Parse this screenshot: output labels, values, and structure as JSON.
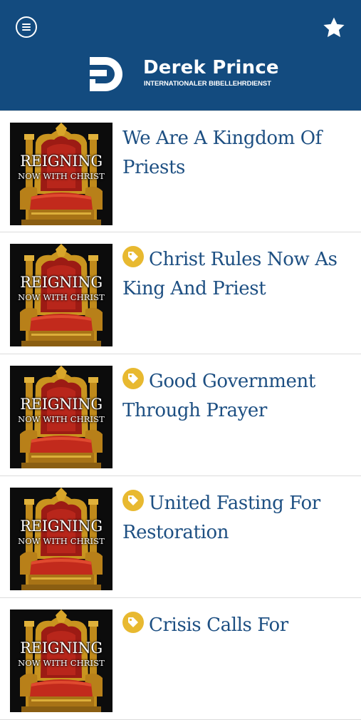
{
  "header": {
    "brand_name": "Derek Prince",
    "brand_sub": "INTERNATIONALER BIBELLEHRDIENST",
    "menu_icon": "menu-icon",
    "favorite_icon": "star-icon",
    "background": "#134b7f"
  },
  "thumbnail": {
    "line1": "REIGNING",
    "line2": "NOW WITH CHRIST"
  },
  "items": [
    {
      "title": "We Are A Kingdom Of Priests",
      "tagged": false
    },
    {
      "title": "Christ Rules Now As King And Priest",
      "tagged": true
    },
    {
      "title": "Good Government Through Prayer",
      "tagged": true
    },
    {
      "title": "United Fasting For Restoration",
      "tagged": true
    },
    {
      "title": "Crisis Calls For",
      "tagged": true
    }
  ],
  "colors": {
    "title": "#1d4f82",
    "tag": "#e8b930",
    "divider": "#dcdcdc"
  }
}
